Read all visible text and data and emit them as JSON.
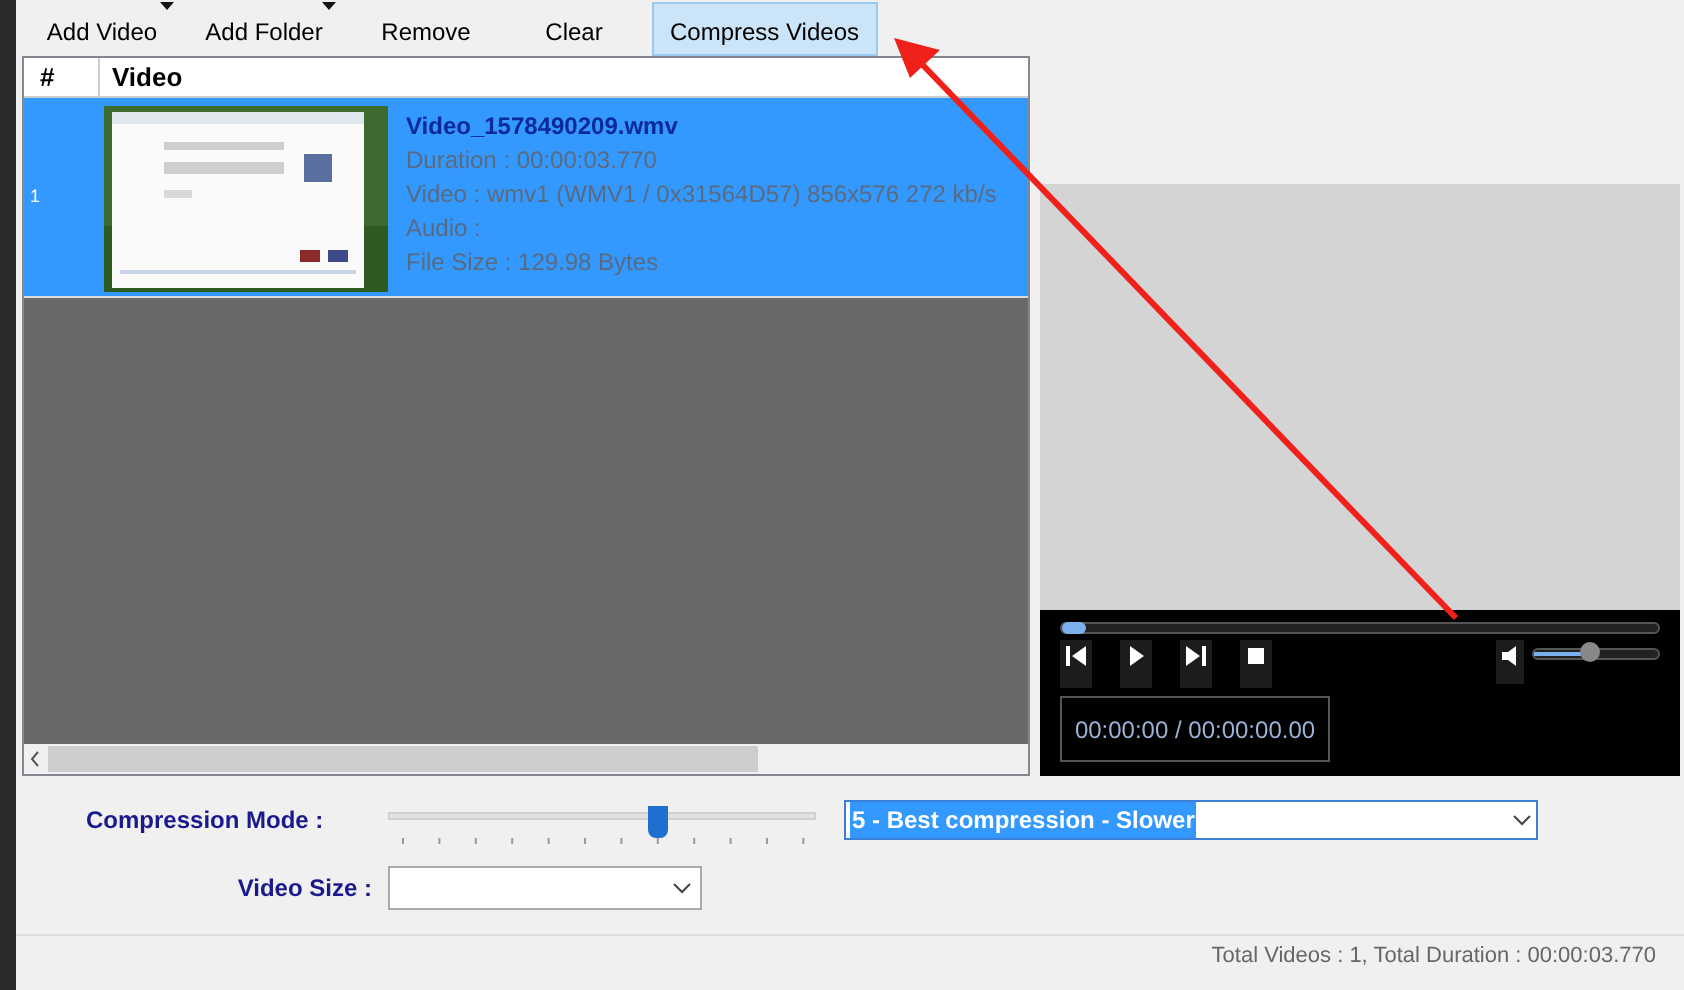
{
  "toolbar": [
    {
      "label": "Add Video",
      "dropdown": true,
      "selected": false
    },
    {
      "label": "Add Folder",
      "dropdown": true,
      "selected": false
    },
    {
      "label": "Remove",
      "dropdown": false,
      "selected": false
    },
    {
      "label": "Clear",
      "dropdown": false,
      "selected": false
    },
    {
      "label": "Compress Videos",
      "dropdown": false,
      "selected": true
    }
  ],
  "video_list": {
    "columns": [
      "#",
      "Video"
    ],
    "rows": [
      {
        "number": "1",
        "selected": true,
        "thumbnail": {
          "kind": "picture"
        },
        "title": "Video_1578490209.wmv",
        "details": [
          "Duration : 00:00:03.770",
          "Video : wmv1 (WMV1 / 0x31564D57) 856x576 272 kb/s",
          "Audio :",
          "File Size : 129.98 Bytes"
        ]
      }
    ]
  },
  "player": {
    "seek": {
      "level": 0.0
    },
    "volume": {
      "level": 0.45
    },
    "time": "00:00:00 / 00:00:00.00"
  },
  "compression_mode": {
    "label": "Compression Mode :",
    "slider": {
      "level": 0.63
    },
    "value": "5 - Best compression - Slower"
  },
  "video_size": {
    "label": "Video Size :"
  },
  "status_bar": "Total Videos : 1, Total Duration : 00:00:03.770"
}
